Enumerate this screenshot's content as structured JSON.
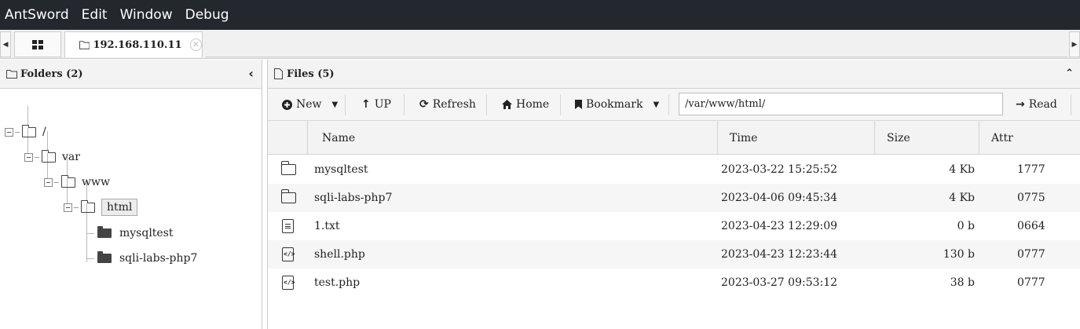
{
  "menu": [
    "AntSword",
    "Edit",
    "Window",
    "Debug"
  ],
  "tabs": {
    "left_scroll": "◀",
    "right_scroll": "▶",
    "home_icon": "grid-icon",
    "active_label": "192.168.110.11",
    "close_glyph": "✕"
  },
  "folders": {
    "header": "Folders (2)",
    "collapse_glyph": "‹",
    "tree": {
      "root": "/",
      "var": "var",
      "www": "www",
      "html": "html",
      "child1": "mysqltest",
      "child2": "sqli-labs-php7"
    }
  },
  "files": {
    "header": "Files (5)",
    "collapse_glyph": "⌃",
    "toolbar": {
      "new_label": "New",
      "up_label": "UP",
      "refresh_label": "Refresh",
      "home_label": "Home",
      "bookmark_label": "Bookmark",
      "path_value": "/var/www/html/",
      "read_label": "Read"
    },
    "columns": {
      "name": "Name",
      "time": "Time",
      "size": "Size",
      "attr": "Attr"
    },
    "rows": [
      {
        "name": "mysqltest",
        "time": "2023-03-22 15:25:52",
        "size": "4 Kb",
        "attr": "1777",
        "icon": "folder-icon"
      },
      {
        "name": "sqli-labs-php7",
        "time": "2023-04-06 09:45:34",
        "size": "4 Kb",
        "attr": "0775",
        "icon": "folder-icon"
      },
      {
        "name": "1.txt",
        "time": "2023-04-23 12:29:09",
        "size": "0 b",
        "attr": "0664",
        "icon": "text-file-icon"
      },
      {
        "name": "shell.php",
        "time": "2023-04-23 12:23:44",
        "size": "130 b",
        "attr": "0777",
        "icon": "code-file-icon"
      },
      {
        "name": "test.php",
        "time": "2023-03-27 09:53:12",
        "size": "38 b",
        "attr": "0777",
        "icon": "code-file-icon"
      }
    ]
  }
}
